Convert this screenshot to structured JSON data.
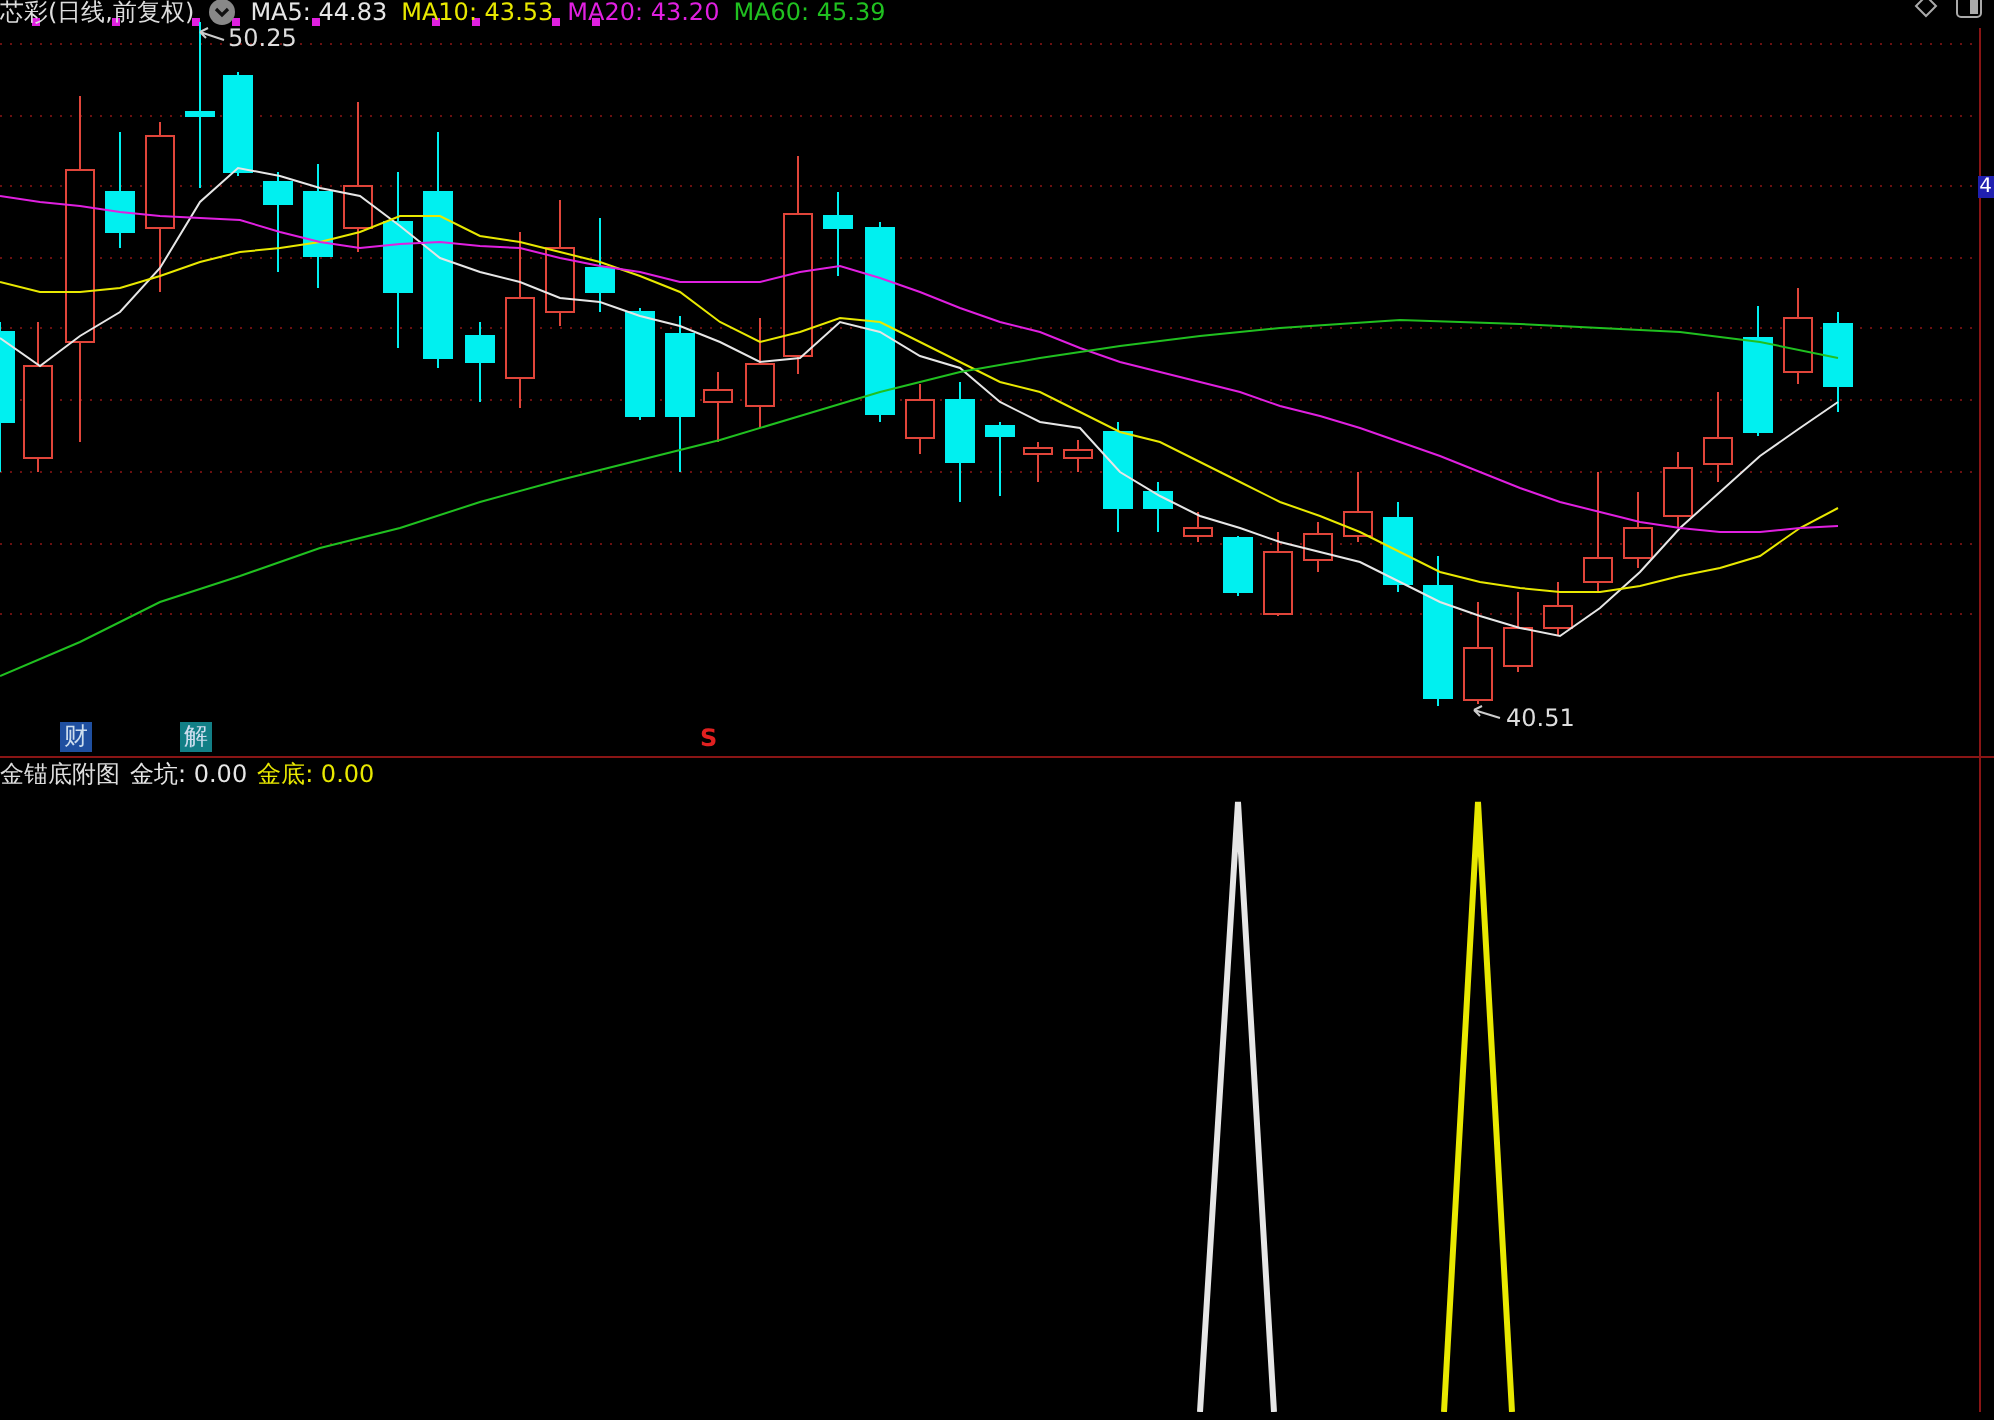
{
  "header": {
    "title": "芯彩(日线,前复权)",
    "moving_averages": [
      {
        "label": "MA5: 44.83",
        "color": "#e6e6e6"
      },
      {
        "label": "MA10: 43.53",
        "color": "#e8e800"
      },
      {
        "label": "MA20: 43.20",
        "color": "#e020e0"
      },
      {
        "label": "MA60: 45.39",
        "color": "#20c020"
      }
    ]
  },
  "price_chart": {
    "high_label": "50.25",
    "low_label": "40.51",
    "axis_label": "4",
    "markers": [
      {
        "label": "财",
        "kind": "badge",
        "color": "#1f4fa0"
      },
      {
        "label": "解",
        "kind": "badge",
        "color": "#127f86"
      },
      {
        "label": "S",
        "kind": "signal",
        "color": "#e02020"
      }
    ]
  },
  "indicator": {
    "title": "金锚底附图",
    "values": [
      {
        "label": "金坑: 0.00",
        "color": "#e6e6e6"
      },
      {
        "label": "金底: 0.00",
        "color": "#e8e800"
      }
    ]
  }
}
